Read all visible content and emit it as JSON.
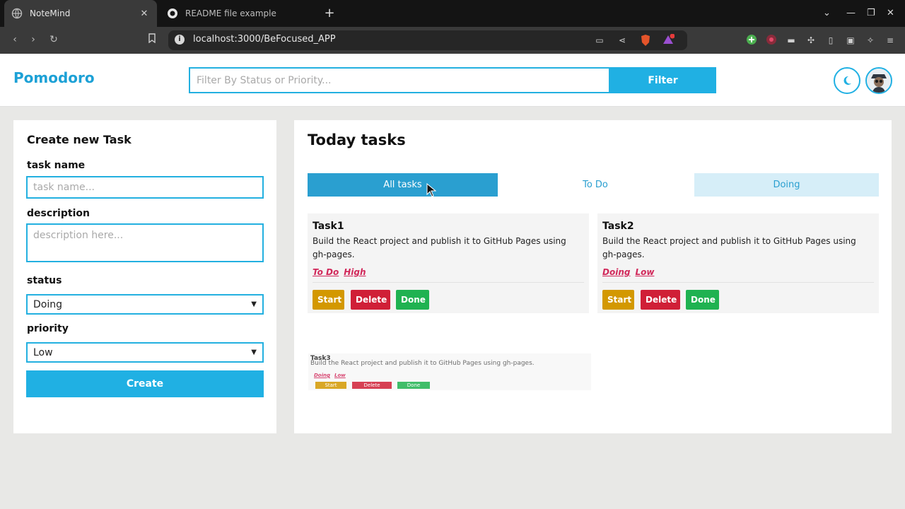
{
  "browser": {
    "tabs": [
      {
        "title": "NoteMind",
        "active": true
      },
      {
        "title": "README file example",
        "active": false
      }
    ],
    "url": "localhost:3000/BeFocused_APP",
    "extension_badge": "1"
  },
  "header": {
    "brand": "Pomodoro",
    "filter_placeholder": "Filter By Status or Priority...",
    "filter_value": "",
    "filter_button": "Filter"
  },
  "create": {
    "title": "Create new Task",
    "task_name_label": "task name",
    "task_name_placeholder": "task name...",
    "description_label": "description",
    "description_placeholder": "description here...",
    "status_label": "status",
    "status_value": "Doing",
    "priority_label": "priority",
    "priority_value": "Low",
    "create_button": "Create"
  },
  "today": {
    "title": "Today tasks",
    "tabs": {
      "all": "All tasks",
      "todo": "To Do",
      "doing": "Doing"
    },
    "tasks": [
      {
        "name": "Task1",
        "description": "Build the React project and publish it to GitHub Pages using gh-pages.",
        "status": "To Do",
        "priority": "High",
        "start": "Start",
        "delete": "Delete",
        "done": "Done"
      },
      {
        "name": "Task2",
        "description": "Build the React project and publish it to GitHub Pages using gh-pages.",
        "status": "Doing",
        "priority": "Low",
        "start": "Start",
        "delete": "Delete",
        "done": "Done"
      },
      {
        "name": "Task3",
        "description": "Build the React project and publish it to GitHub Pages using gh-pages.",
        "status": "Doing",
        "priority": "Low",
        "start": "Start",
        "delete": "Delete",
        "done": "Done"
      }
    ]
  },
  "colors": {
    "accent": "#20b0e3",
    "tab_active": "#2a9fd0",
    "tag": "#d1285a",
    "start": "#d39800",
    "delete": "#d01f37",
    "done": "#1fb251"
  }
}
